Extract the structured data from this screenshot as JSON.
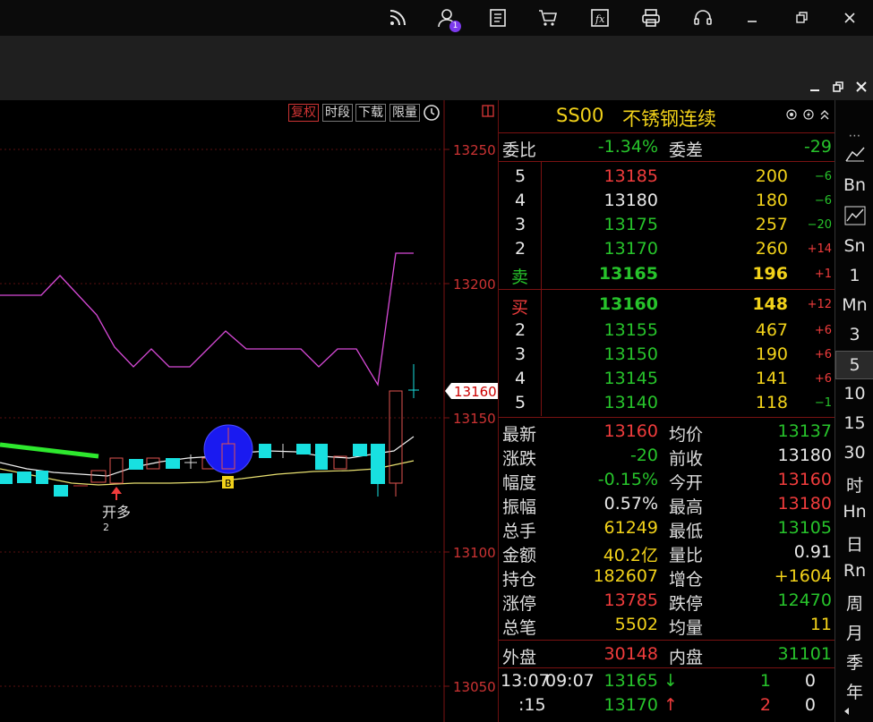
{
  "topbar": {
    "icons": [
      "rss-icon",
      "user-icon",
      "document-icon",
      "cart-icon",
      "formula-icon",
      "print-icon",
      "headset-icon",
      "minimize-icon",
      "restore-icon",
      "close-icon"
    ],
    "user_badge": "1",
    "formula_label": "fx"
  },
  "chart": {
    "buttons": [
      "复权",
      "时段",
      "下载",
      "限量"
    ],
    "price_ticks": [
      "13250",
      "13200",
      "13150",
      "13100",
      "13050"
    ],
    "current_price_tag": "13160",
    "annotation": "开多",
    "annotation_sub": "2",
    "marker_label": "B"
  },
  "quote": {
    "code": "SS00",
    "name": "不锈钢连续",
    "weibi_label": "委比",
    "weibi_value": "-1.34%",
    "weicha_label": "委差",
    "weicha_value": "-29",
    "sell_rows": [
      {
        "level": "5",
        "price": "13185",
        "vol": "200",
        "chg": "−6"
      },
      {
        "level": "4",
        "price": "13180",
        "vol": "180",
        "chg": "−6"
      },
      {
        "level": "3",
        "price": "13175",
        "vol": "257",
        "chg": "−20"
      },
      {
        "level": "2",
        "price": "13170",
        "vol": "260",
        "chg": "+14"
      },
      {
        "level": "卖",
        "price": "13165",
        "vol": "196",
        "chg": "+1"
      }
    ],
    "buy_rows": [
      {
        "level": "买",
        "price": "13160",
        "vol": "148",
        "chg": "+12"
      },
      {
        "level": "2",
        "price": "13155",
        "vol": "467",
        "chg": "+6"
      },
      {
        "level": "3",
        "price": "13150",
        "vol": "190",
        "chg": "+6"
      },
      {
        "level": "4",
        "price": "13145",
        "vol": "141",
        "chg": "+6"
      },
      {
        "level": "5",
        "price": "13140",
        "vol": "118",
        "chg": "−1"
      }
    ],
    "stats": [
      {
        "l1": "最新",
        "v1": "13160",
        "l2": "均价",
        "v2": "13137"
      },
      {
        "l1": "涨跌",
        "v1": "-20",
        "l2": "前收",
        "v2": "13180"
      },
      {
        "l1": "幅度",
        "v1": "-0.15%",
        "l2": "今开",
        "v2": "13160"
      },
      {
        "l1": "振幅",
        "v1": "0.57%",
        "l2": "最高",
        "v2": "13180"
      },
      {
        "l1": "总手",
        "v1": "61249",
        "l2": "最低",
        "v2": "13105"
      },
      {
        "l1": "金额",
        "v1": "40.2亿",
        "l2": "量比",
        "v2": "0.91"
      },
      {
        "l1": "持仓",
        "v1": "182607",
        "l2": "增仓",
        "v2": "+1604"
      },
      {
        "l1": "涨停",
        "v1": "13785",
        "l2": "跌停",
        "v2": "12470"
      },
      {
        "l1": "总笔",
        "v1": "5502",
        "l2": "均量",
        "v2": "11"
      }
    ],
    "waipan_label": "外盘",
    "waipan_value": "30148",
    "neipan_label": "内盘",
    "neipan_value": "31101",
    "ticks": [
      {
        "time": "13:07",
        "time2": "09:07",
        "price": "13165",
        "dir": "↓",
        "vol": "1",
        "extra": "0"
      },
      {
        "time": "",
        "time2": ":15",
        "price": "13170",
        "dir": "↑",
        "vol": "2",
        "extra": "0"
      }
    ]
  },
  "sidebar": {
    "items": [
      "Bn",
      "Sn",
      "1",
      "Mn",
      "3",
      "5",
      "10",
      "15",
      "30",
      "时",
      "Hn",
      "日",
      "Rn",
      "周",
      "月",
      "季",
      "年"
    ],
    "active": "5",
    "dots": "⋯"
  },
  "colors": {
    "up": "#f03c3c",
    "down": "#27c32b",
    "accent_yellow": "#f2d21a",
    "cyan": "#18e0e0",
    "magenta": "#d84ad8"
  }
}
